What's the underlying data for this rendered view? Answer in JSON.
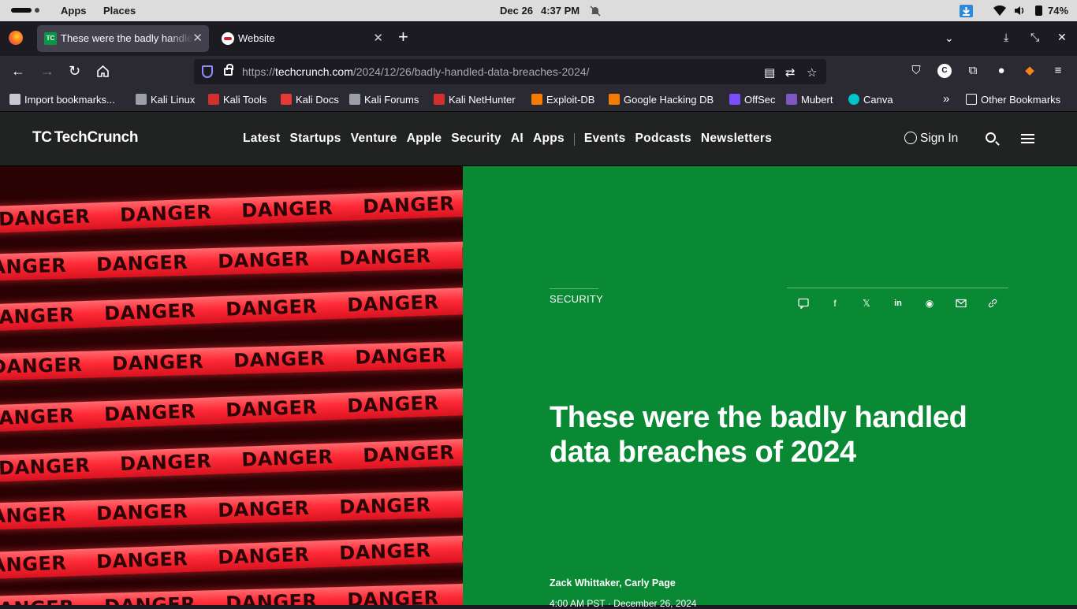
{
  "system": {
    "apps": "Apps",
    "places": "Places",
    "date": "Dec 26",
    "time": "4:37 PM",
    "battery": "74%"
  },
  "tabs": [
    {
      "title": "These were the badly handled data breaches of 2024",
      "favicon": "TC"
    },
    {
      "title": "Website"
    }
  ],
  "address": {
    "scheme": "https://",
    "host": "techcrunch.com",
    "path": "/2024/12/26/badly-handled-data-breaches-2024/"
  },
  "bookmarks": [
    {
      "label": "Import bookmarks...",
      "color": "#c8c8d0"
    },
    {
      "label": "Kali Linux",
      "color": "#9aa0a6"
    },
    {
      "label": "Kali Tools",
      "color": "#d32f2f"
    },
    {
      "label": "Kali Docs",
      "color": "#e53935"
    },
    {
      "label": "Kali Forums",
      "color": "#9aa0a6"
    },
    {
      "label": "Kali NetHunter",
      "color": "#d32f2f"
    },
    {
      "label": "Exploit-DB",
      "color": "#f57c00"
    },
    {
      "label": "Google Hacking DB",
      "color": "#f57c00"
    },
    {
      "label": "OffSec",
      "color": "#7c4dff"
    },
    {
      "label": "Mubert",
      "color": "#7e57c2"
    },
    {
      "label": "Canva",
      "color": "#00c4cc"
    }
  ],
  "other_bookmarks": "Other Bookmarks",
  "site": {
    "logo": "TechCrunch",
    "nav": [
      "Latest",
      "Startups",
      "Venture",
      "Apple",
      "Security",
      "AI",
      "Apps"
    ],
    "nav2": [
      "Events",
      "Podcasts",
      "Newsletters"
    ],
    "sign_in": "Sign In"
  },
  "article": {
    "section": "SECURITY",
    "title": "These were the badly handled data breaches of 2024",
    "authors": "Zack Whittaker, Carly Page",
    "date": "4:00 AM PST · December 26, 2024",
    "panel_color": "#0a8935",
    "tape_word": "DANGER"
  }
}
